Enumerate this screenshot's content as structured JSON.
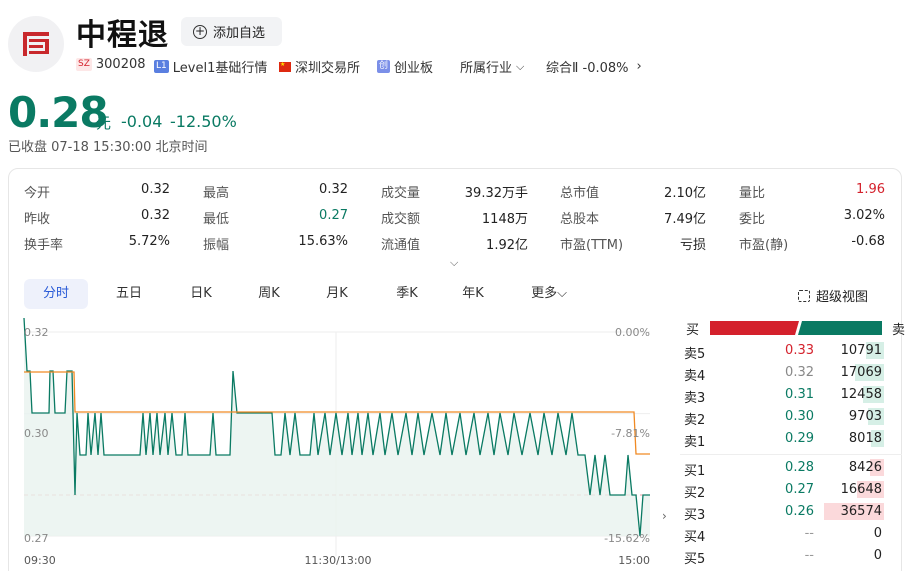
{
  "header": {
    "title": "中程退",
    "add_label": "添加自选",
    "market_tag": "SZ",
    "code": "300208",
    "level_tag": "L1",
    "level_label": "Level1基础行情",
    "exchange": "深圳交易所",
    "board_tag": "创",
    "board": "创业板",
    "industry_label": "所属行业",
    "industry_value": "综合Ⅱ -0.08%"
  },
  "quote": {
    "price": "0.28",
    "unit": "元",
    "change": "-0.04",
    "change_pct": "-12.50%",
    "status": "已收盘  07-18 15:30:00 北京时间"
  },
  "stats": [
    [
      {
        "k": "今开",
        "v": "0.32"
      },
      {
        "k": "最高",
        "v": "0.32"
      },
      {
        "k": "成交量",
        "v": "39.32万手"
      },
      {
        "k": "总市值",
        "v": "2.10亿"
      },
      {
        "k": "量比",
        "v": "1.96"
      }
    ],
    [
      {
        "k": "昨收",
        "v": "0.32"
      },
      {
        "k": "最低",
        "v": "0.27"
      },
      {
        "k": "成交额",
        "v": "1148万"
      },
      {
        "k": "总股本",
        "v": "7.49亿"
      },
      {
        "k": "委比",
        "v": "3.02%"
      }
    ],
    [
      {
        "k": "换手率",
        "v": "5.72%"
      },
      {
        "k": "振幅",
        "v": "15.63%"
      },
      {
        "k": "流通值",
        "v": "1.92亿"
      },
      {
        "k": "市盈(TTM)",
        "v": "亏损"
      },
      {
        "k": "市盈(静)",
        "v": "-0.68"
      }
    ]
  ],
  "colors": {
    "up": "#d4212c",
    "down": "#0a7a63",
    "accent": "#2a5bd7",
    "avg": "#f08a24"
  },
  "tabs": [
    "分时",
    "五日",
    "日K",
    "周K",
    "月K",
    "季K",
    "年K",
    "更多"
  ],
  "advanced_view": "超级视图",
  "chart_data": {
    "type": "line",
    "y_labels": [
      "0.32",
      "0.30",
      "0.27"
    ],
    "pct_labels": [
      "0.00%",
      "-7.81%",
      "-15.62%"
    ],
    "x_labels": [
      "09:30",
      "11:30/13:00",
      "15:00"
    ],
    "ylim": [
      0.27,
      0.32
    ],
    "prev_close": 0.32
  },
  "orderbook": {
    "buy_label": "买",
    "sell_label": "卖",
    "asks": [
      {
        "label": "卖5",
        "price": "0.33",
        "vol": "10791",
        "ratio": 0.14
      },
      {
        "label": "卖4",
        "price": "0.32",
        "vol": "17069",
        "ratio": 0.22
      },
      {
        "label": "卖3",
        "price": "0.31",
        "vol": "12458",
        "ratio": 0.16
      },
      {
        "label": "卖2",
        "price": "0.30",
        "vol": "9703",
        "ratio": 0.12
      },
      {
        "label": "卖1",
        "price": "0.29",
        "vol": "8018",
        "ratio": 0.1
      }
    ],
    "bids": [
      {
        "label": "买1",
        "price": "0.28",
        "vol": "8426",
        "ratio": 0.11
      },
      {
        "label": "买2",
        "price": "0.27",
        "vol": "16648",
        "ratio": 0.21
      },
      {
        "label": "买3",
        "price": "0.26",
        "vol": "36574",
        "ratio": 0.46
      },
      {
        "label": "买4",
        "price": "--",
        "vol": "0",
        "ratio": 0
      },
      {
        "label": "买5",
        "price": "--",
        "vol": "0",
        "ratio": 0
      }
    ]
  }
}
